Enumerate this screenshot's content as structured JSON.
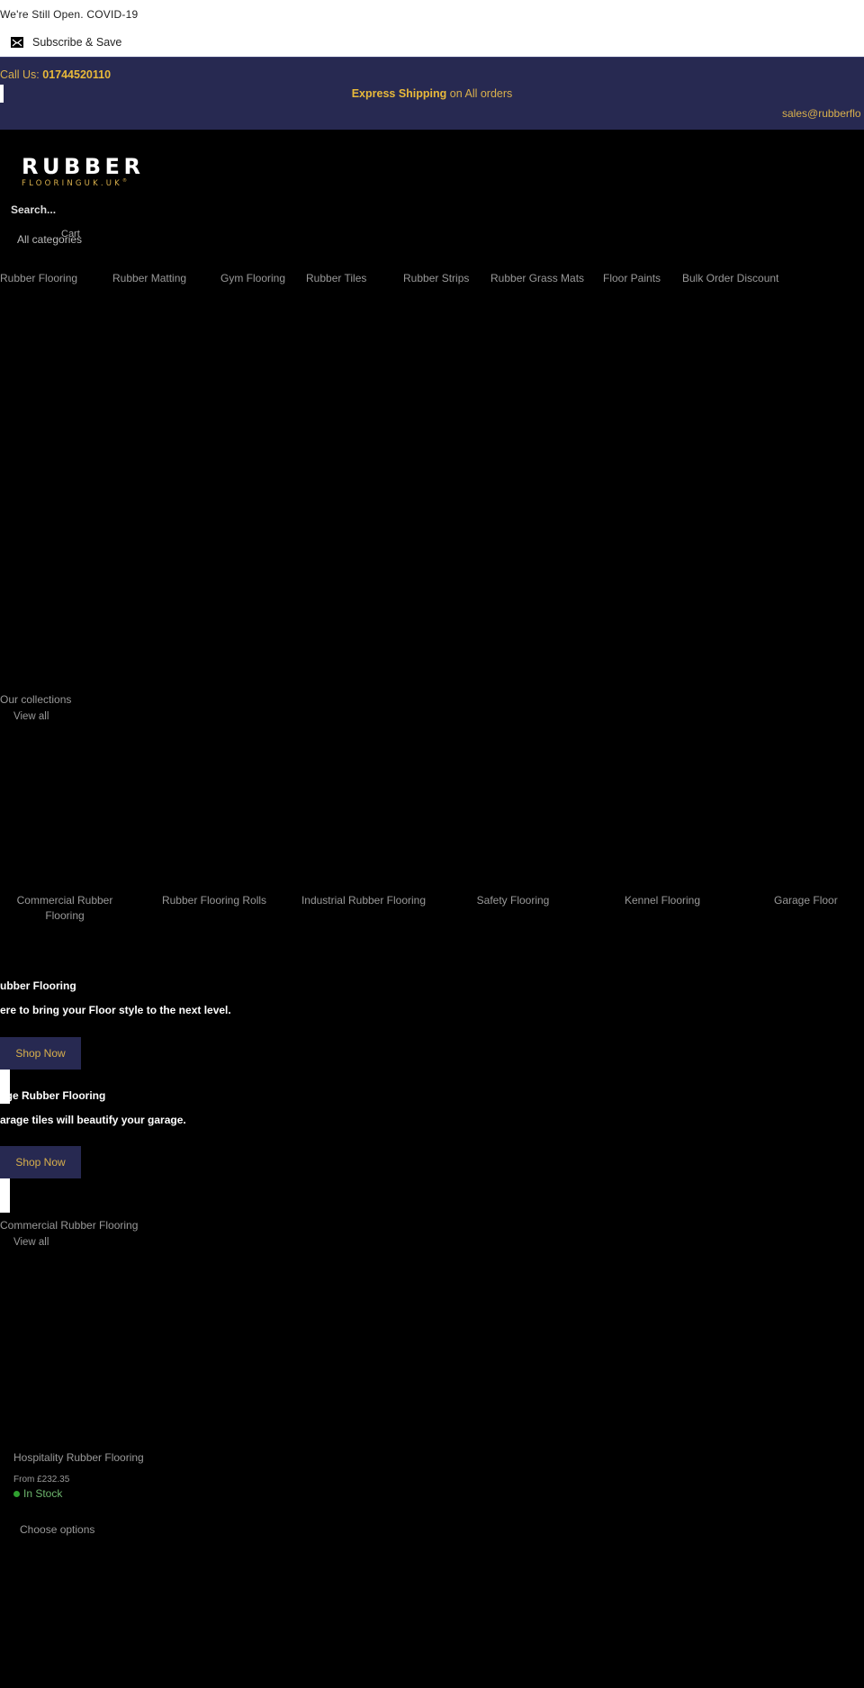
{
  "topbar": {
    "notice": "We're Still Open. COVID-19",
    "subscribe_label": "Subscribe & Save",
    "subscribe_icon": "mail-icon"
  },
  "announcement": {
    "call_prefix": "Call Us:",
    "phone": "01744520110",
    "shipping_bold": "Express Shipping",
    "shipping_rest": "on All orders",
    "email": "sales@rubberflo"
  },
  "header": {
    "logo_main": "RUBBER",
    "logo_sub": "FLOORINGUK.UK",
    "logo_mark": "®",
    "search_placeholder": "Search...",
    "all_categories": "All categories",
    "cart_label": "Cart"
  },
  "nav": {
    "items": [
      {
        "label": "Rubber Flooring"
      },
      {
        "label": "Rubber Matting"
      },
      {
        "label": "Gym Flooring"
      },
      {
        "label": "Rubber Tiles"
      },
      {
        "label": "Rubber Strips"
      },
      {
        "label": "Rubber Grass Mats"
      },
      {
        "label": "Floor Paints"
      },
      {
        "label": "Bulk Order Discount"
      }
    ]
  },
  "collections": {
    "title": "Our collections",
    "view_all": "View all",
    "items": [
      {
        "label": "Commercial Rubber Flooring"
      },
      {
        "label": "Rubber Flooring Rolls"
      },
      {
        "label": "Industrial Rubber Flooring"
      },
      {
        "label": "Safety Flooring"
      },
      {
        "label": "Kennel Flooring"
      },
      {
        "label": "Garage Floor"
      }
    ]
  },
  "banners": [
    {
      "title": "ubber Flooring",
      "text": "ere to bring your Floor style to the next level.",
      "button": "Shop Now"
    },
    {
      "title": "age Rubber Flooring",
      "text": "arage tiles will beautify your garage.",
      "button": "Shop Now"
    }
  ],
  "featured": {
    "title": "Commercial Rubber Flooring",
    "view_all": "View all",
    "product": {
      "name": "Hospitality Rubber Flooring",
      "price": "From £232.35",
      "stock": "In Stock",
      "button": "Choose options"
    }
  },
  "colors": {
    "brand_navy": "#272951",
    "brand_gold": "#d9b04c",
    "stock_green": "#2fa02f"
  }
}
